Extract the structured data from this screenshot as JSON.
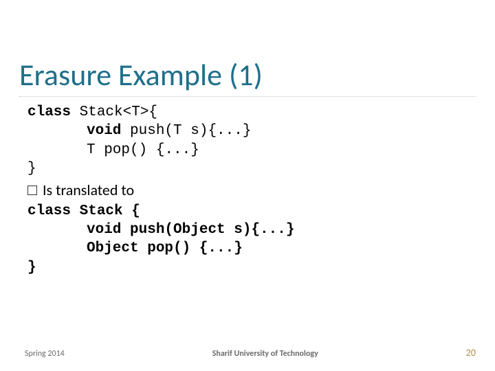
{
  "title": "Erasure Example (1)",
  "code1": {
    "l1a": "class",
    "l1b": " Stack<T>{",
    "l2a": "void",
    "l2b": " push(T s){...}",
    "l3": "T pop() {...}",
    "l4": "}"
  },
  "bullet": "Is translated to",
  "code2": {
    "l1a": "class",
    "l1b": " Stack {",
    "l2a": "void",
    "l2b": " push(Object s){...}",
    "l3": "Object pop() {...}",
    "l4": "}"
  },
  "footer": {
    "left": "Spring 2014",
    "center": "Sharif University of Technology",
    "page": "20"
  }
}
